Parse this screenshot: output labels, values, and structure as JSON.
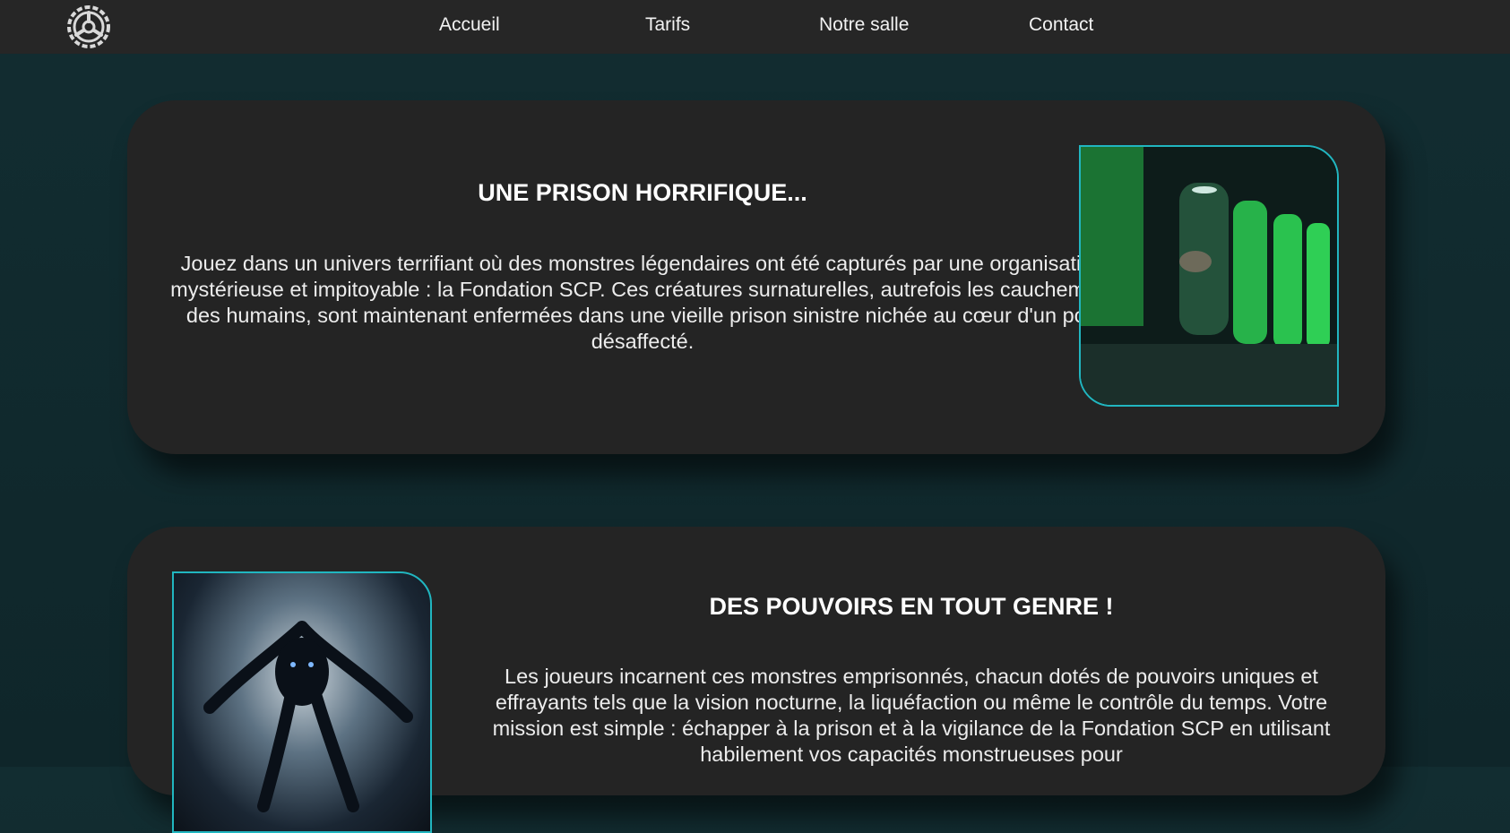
{
  "nav": {
    "logo_icon": "scp-foundation-logo-icon",
    "links": [
      "Accueil",
      "Tarifs",
      "Notre salle",
      "Contact"
    ]
  },
  "sections": [
    {
      "title": "UNE PRISON HORRIFIQUE...",
      "text": "Jouez dans un univers terrifiant où des monstres légendaires ont été capturés par une organisation mystérieuse et impitoyable : la Fondation SCP. Ces créatures surnaturelles, autrefois les cauchemars des humains, sont maintenant enfermées dans une vieille prison sinistre nichée au cœur d'un port désaffecté."
    },
    {
      "title": "DES POUVOIRS EN TOUT GENRE !",
      "text": "Les joueurs incarnent ces monstres emprisonnés, chacun dotés de pouvoirs uniques et effrayants tels que la vision nocturne, la liquéfaction ou même le contrôle du temps. Votre mission est simple : échapper à la prison et à la vigilance de la Fondation SCP en utilisant habilement vos capacités monstrueuses pour"
    }
  ],
  "colors": {
    "accent": "#21b6c0",
    "card_bg": "#242424",
    "nav_bg": "#262626",
    "page_bg": "#122d31"
  }
}
